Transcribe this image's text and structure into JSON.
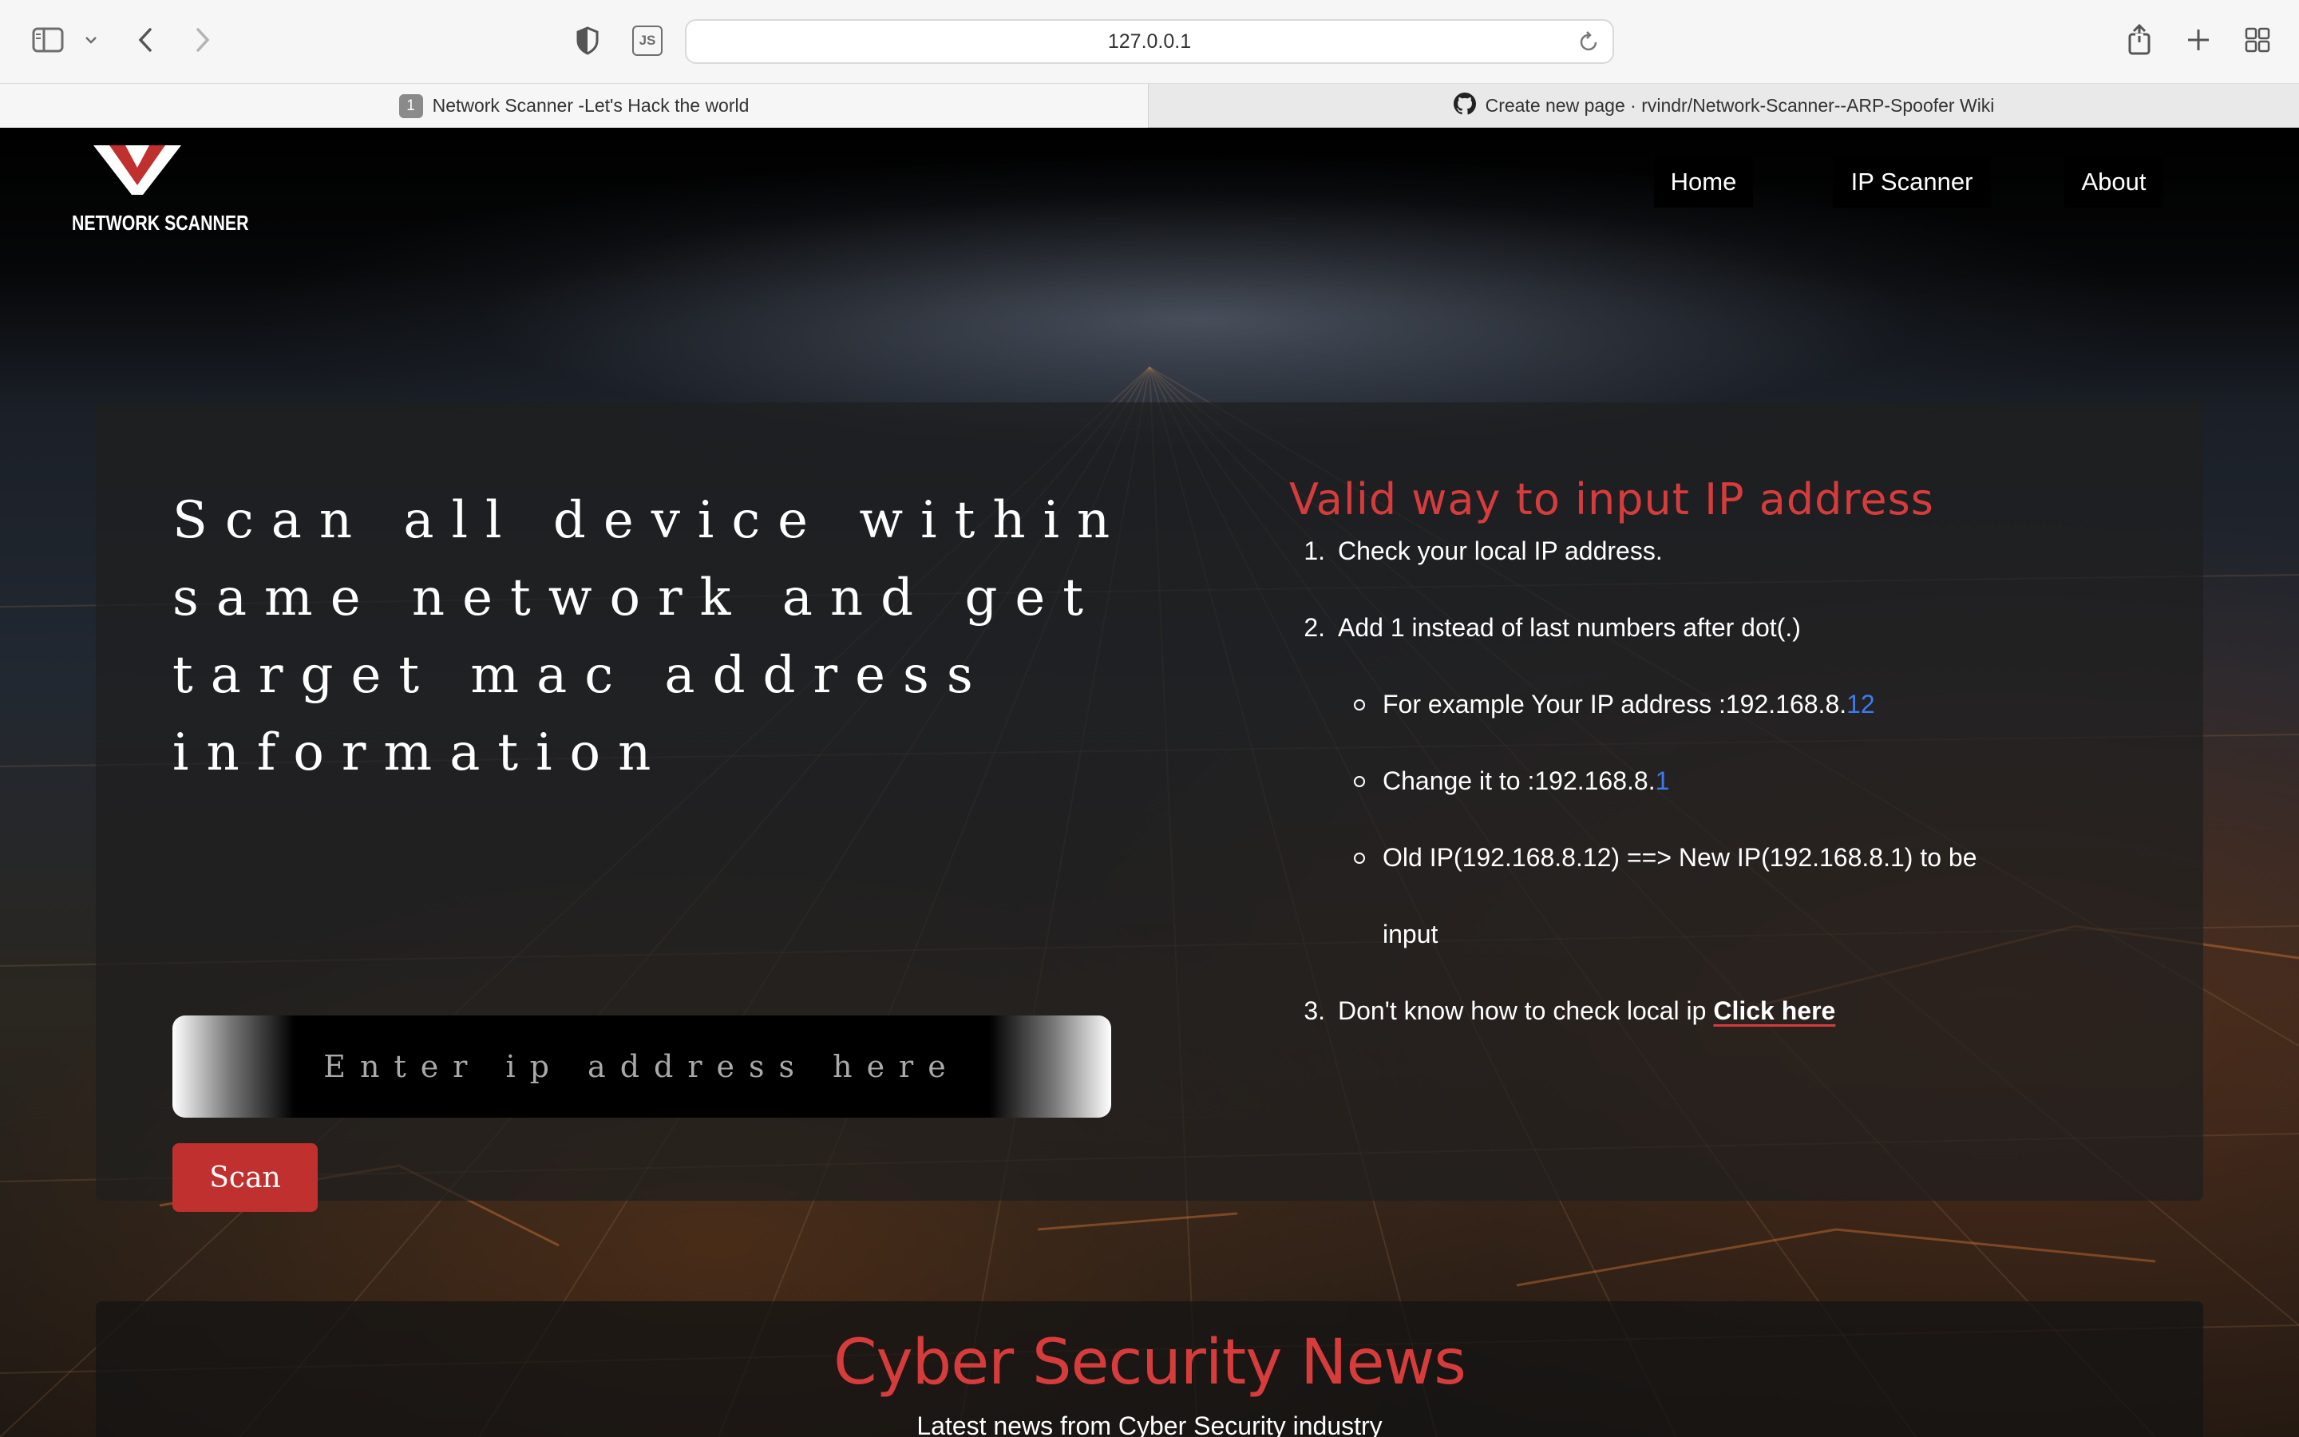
{
  "browser": {
    "url": "127.0.0.1",
    "tabs": [
      {
        "number": "1",
        "title": "Network Scanner -Let's Hack the world",
        "active": true
      },
      {
        "title": "Create new page · rvindr/Network-Scanner--ARP-Spoofer Wiki",
        "icon": "github-icon",
        "active": false
      }
    ],
    "js_badge": "JS"
  },
  "site": {
    "logo_text": "NETWORK SCANNER",
    "nav": [
      "Home",
      "IP Scanner",
      "About"
    ]
  },
  "scanner": {
    "headline": "Scan all device within same network and get target mac address information",
    "input_placeholder": "Enter ip address here",
    "scan_button": "Scan"
  },
  "instructions": {
    "title": "Valid way to input IP address",
    "step1": "Check your local IP address.",
    "step2": "Add 1 instead of last numbers after dot(.)",
    "example_prefix": "For example Your IP address :192.168.8.",
    "example_suffix": "12",
    "change_prefix": "Change it to :192.168.8.",
    "change_suffix": "1",
    "old_new_line1": "Old IP(192.168.8.12) ==> New IP(192.168.8.1) to be",
    "old_new_line2": "input",
    "step3": "Don't know how to check local ip ",
    "step3_link": "Click here"
  },
  "news": {
    "title": "Cyber Security News",
    "subtitle": "Latest news from Cyber Security industry"
  },
  "colors": {
    "accent_red": "#d63c3c",
    "button_red": "#c0302e",
    "highlight_blue": "#3a7cf0"
  }
}
